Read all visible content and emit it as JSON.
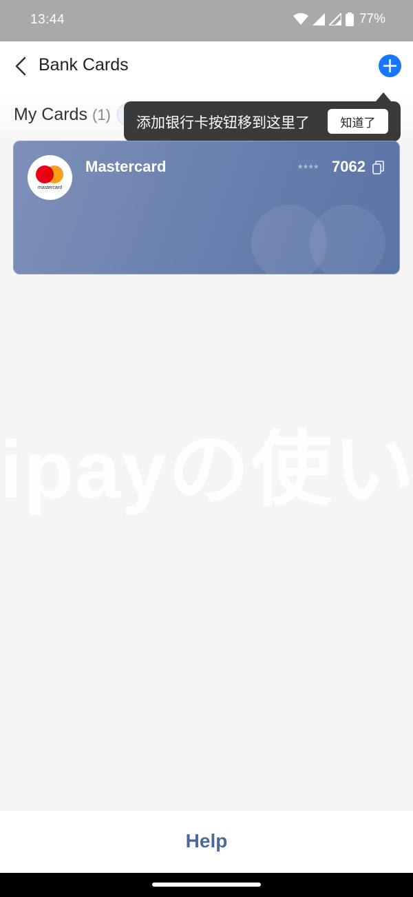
{
  "status_bar": {
    "time": "13:44",
    "battery_percent": "77%",
    "icons": [
      "wifi-icon",
      "signal-icon",
      "signal-icon",
      "battery-icon"
    ]
  },
  "nav": {
    "title": "Bank Cards",
    "back_icon": "chevron-left-icon",
    "add_icon": "plus-icon"
  },
  "section": {
    "title": "My Cards",
    "count": "(1)"
  },
  "tooltip": {
    "text": "添加银行卡按钮移到这里了",
    "button_label": "知道了"
  },
  "card": {
    "brand": "Mastercard",
    "logo_text": "mastercard",
    "mask": "****",
    "last4": "7062"
  },
  "watermark": {
    "text": "ipayの使い"
  },
  "footer": {
    "help_label": "Help"
  },
  "colors": {
    "accent": "#1677ff",
    "card": "#6c82af",
    "help": "#4b6a99",
    "tooltip": "#3a3a3a"
  }
}
